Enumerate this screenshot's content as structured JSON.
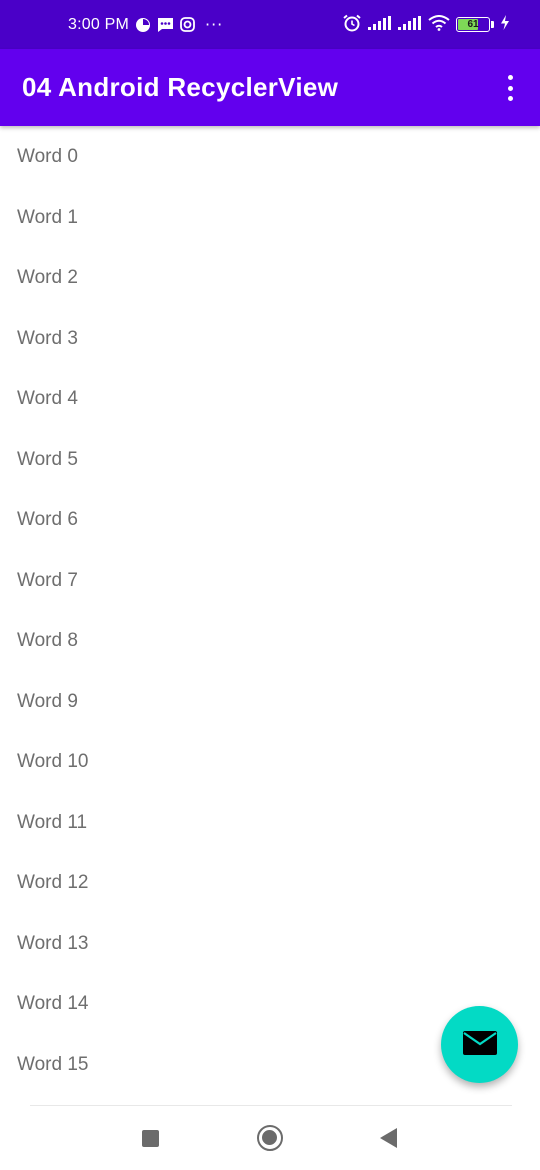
{
  "status_bar": {
    "time": "3:00 PM",
    "more": "···",
    "battery_level": "61",
    "icons": [
      "data-saver-icon",
      "message-icon",
      "instagram-icon",
      "alarm-icon",
      "signal-icon",
      "signal-icon",
      "wifi-icon",
      "battery-icon",
      "charging-icon"
    ]
  },
  "app_bar": {
    "title": "04 Android RecyclerView",
    "menu_icon": "overflow-menu-icon"
  },
  "words": [
    "Word 0",
    "Word 1",
    "Word 2",
    "Word 3",
    "Word 4",
    "Word 5",
    "Word 6",
    "Word 7",
    "Word 8",
    "Word 9",
    "Word 10",
    "Word 11",
    "Word 12",
    "Word 13",
    "Word 14",
    "Word 15"
  ],
  "fab": {
    "icon": "email-icon",
    "color": "#03dac5"
  },
  "nav_bar": {
    "icons": [
      "recents-icon",
      "home-icon",
      "back-icon"
    ]
  },
  "colors": {
    "primary": "#6200ee",
    "primary_dark": "#4a00c8",
    "accent": "#03dac5"
  }
}
